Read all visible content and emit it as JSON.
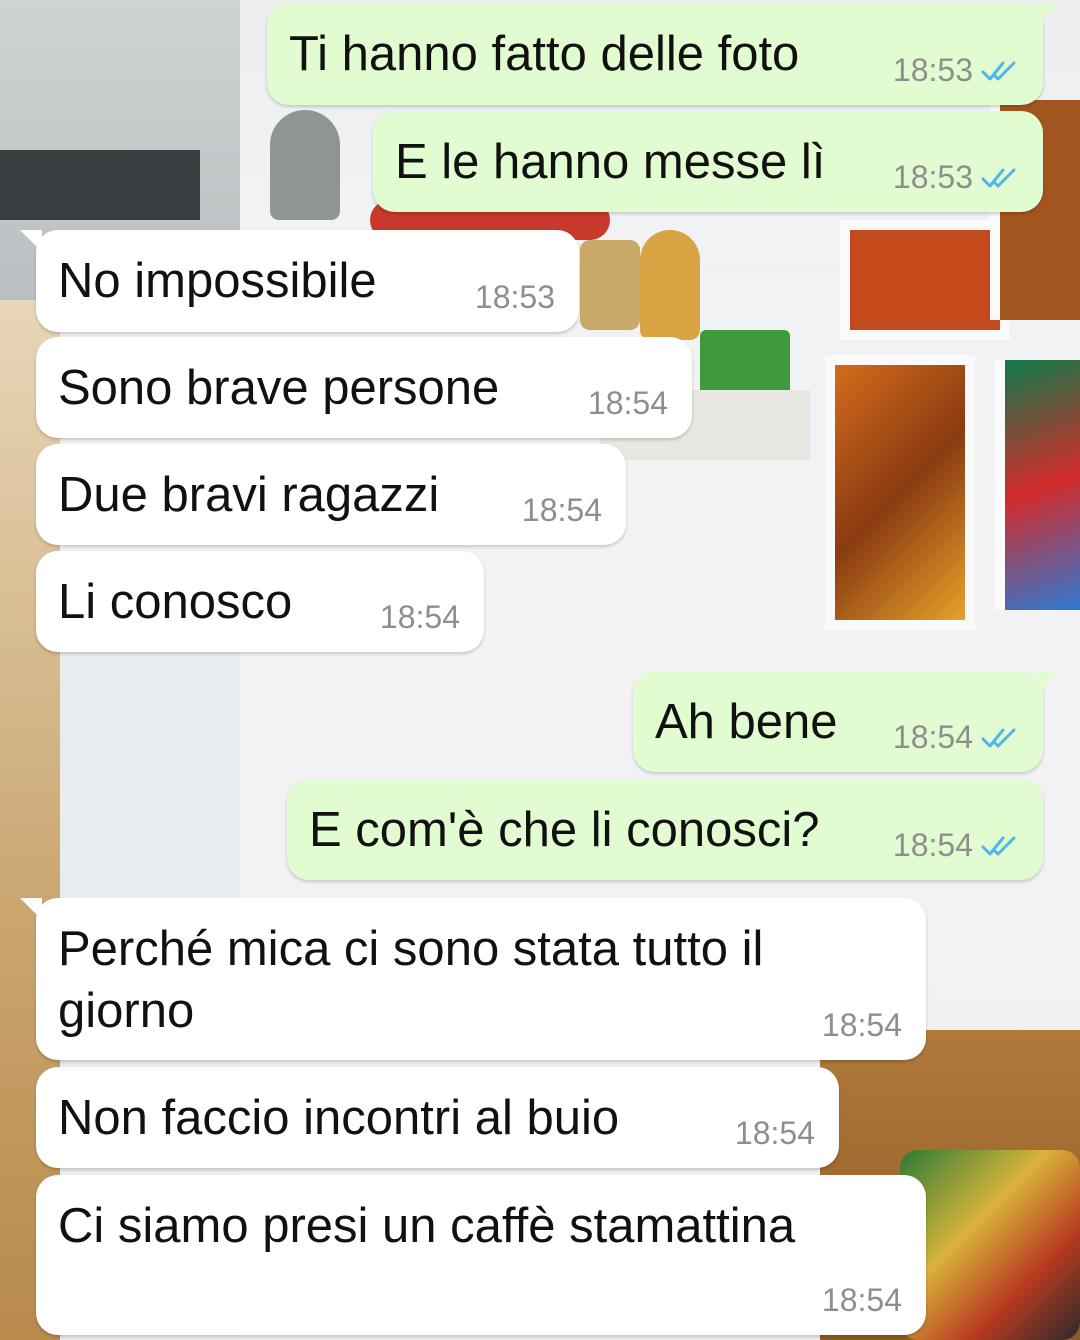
{
  "messages": [
    {
      "direction": "out",
      "text": "Ti hanno fatto delle foto",
      "time": "18:53",
      "status": "read"
    },
    {
      "direction": "out",
      "text": "E le hanno messe lì",
      "time": "18:53",
      "status": "read"
    },
    {
      "direction": "in",
      "text": "No impossibile",
      "time": "18:53"
    },
    {
      "direction": "in",
      "text": "Sono brave persone",
      "time": "18:54"
    },
    {
      "direction": "in",
      "text": "Due bravi ragazzi",
      "time": "18:54"
    },
    {
      "direction": "in",
      "text": "Li conosco",
      "time": "18:54"
    },
    {
      "direction": "out",
      "text": "Ah bene",
      "time": "18:54",
      "status": "read"
    },
    {
      "direction": "out",
      "text": "E com'è che li conosci?",
      "time": "18:54",
      "status": "read"
    },
    {
      "direction": "in",
      "text": "Perché mica ci sono stata tutto il\ngiorno",
      "time": "18:54"
    },
    {
      "direction": "in",
      "text": "Non faccio incontri al buio",
      "time": "18:54"
    },
    {
      "direction": "in",
      "text": "Ci siamo presi un caffè stamattina",
      "time": "18:54"
    }
  ],
  "icons": {
    "read_receipt": "double-check-icon"
  },
  "colors": {
    "incoming_bubble": "#ffffff",
    "outgoing_bubble": "#e2fcd1",
    "read_tick": "#4fb6ec",
    "timestamp": "#8e8e8e"
  }
}
